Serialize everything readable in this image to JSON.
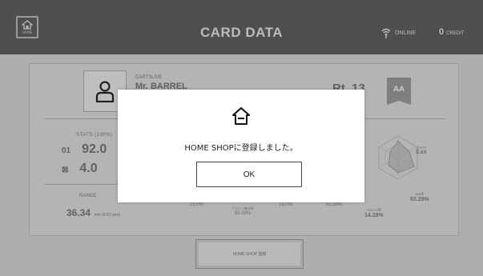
{
  "header": {
    "home_label": "HOME",
    "title": "CARD DATA",
    "online_label": "ONLINE",
    "credit_count": "0",
    "credit_label": "CREDIT"
  },
  "card": {
    "brand": "DARTSLIVE",
    "player_name": "Mr. BARREL",
    "rating_label": "Rt.",
    "rating_value": "13",
    "rank": "AA",
    "stats_label": "STATS (100%)",
    "stats": [
      {
        "icon": "01",
        "value": "92.0"
      },
      {
        "icon": "⊠",
        "value": "4.0"
      }
    ],
    "range_label": "RANGE",
    "range_value": "36.34",
    "range_unit": "mm (9.50 mm)",
    "mini_stats": [
      {
        "value": "25.0%"
      },
      {
        "title": "ブルソン総合率",
        "value": "63.28%"
      },
      {
        "value": "23.0%"
      },
      {
        "value": "81.28%"
      }
    ],
    "side_stats": [
      {
        "title": "STATS",
        "value": "3.xx"
      },
      {
        "title": "Bull率",
        "value": "63.28%"
      },
      {
        "title": "TRIPLE率",
        "value": "14.28%"
      }
    ],
    "register_button": "HOME SHOP 登録"
  },
  "modal": {
    "message": "HOME SHOPに登録しました。",
    "ok_label": "OK"
  },
  "colors": {
    "topbar": "#4f4f4f",
    "background": "#bdbdbd",
    "modal_bg": "#ffffff",
    "rank_badge": "#8a8a8a"
  }
}
